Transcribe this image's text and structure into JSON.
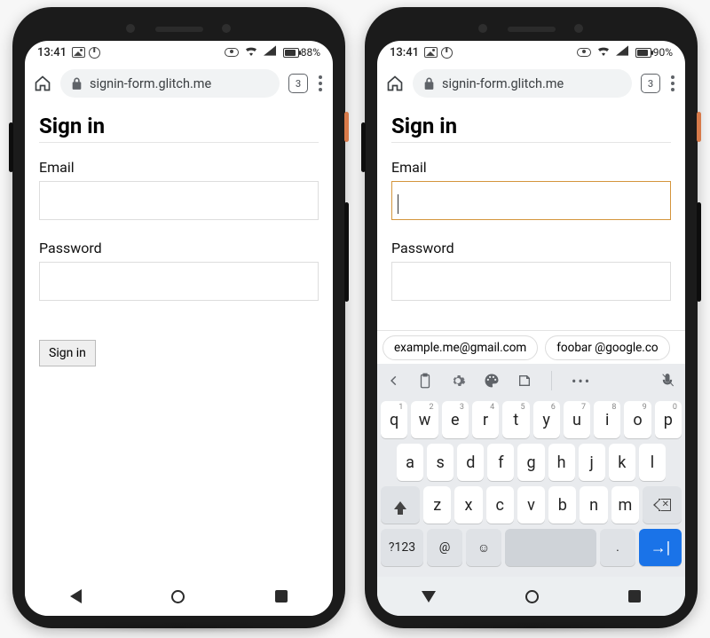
{
  "phones": [
    {
      "status": {
        "time": "13:41",
        "battery_pct": "88%",
        "battery_fill": 0.88
      },
      "omni": {
        "url": "signin-form.glitch.me",
        "tabcount": "3"
      },
      "page": {
        "heading": "Sign in",
        "email_label": "Email",
        "password_label": "Password",
        "submit": "Sign in",
        "email_focused": false
      },
      "keyboard_visible": false
    },
    {
      "status": {
        "time": "13:41",
        "battery_pct": "90%",
        "battery_fill": 0.9
      },
      "omni": {
        "url": "signin-form.glitch.me",
        "tabcount": "3"
      },
      "page": {
        "heading": "Sign in",
        "email_label": "Email",
        "password_label": "Password",
        "submit": "Sign in",
        "email_focused": true
      },
      "keyboard_visible": true,
      "suggestions": [
        "example.me@gmail.com",
        "foobar @google.co"
      ],
      "keyboard": {
        "row1": [
          {
            "k": "q",
            "s": "1"
          },
          {
            "k": "w",
            "s": "2"
          },
          {
            "k": "e",
            "s": "3"
          },
          {
            "k": "r",
            "s": "4"
          },
          {
            "k": "t",
            "s": "5"
          },
          {
            "k": "y",
            "s": "6"
          },
          {
            "k": "u",
            "s": "7"
          },
          {
            "k": "i",
            "s": "8"
          },
          {
            "k": "o",
            "s": "9"
          },
          {
            "k": "p",
            "s": "0"
          }
        ],
        "row2": [
          "a",
          "s",
          "d",
          "f",
          "g",
          "h",
          "j",
          "k",
          "l"
        ],
        "row3": [
          "z",
          "x",
          "c",
          "v",
          "b",
          "n",
          "m"
        ],
        "sym": "?123",
        "at": "@",
        "dot": "."
      }
    }
  ]
}
